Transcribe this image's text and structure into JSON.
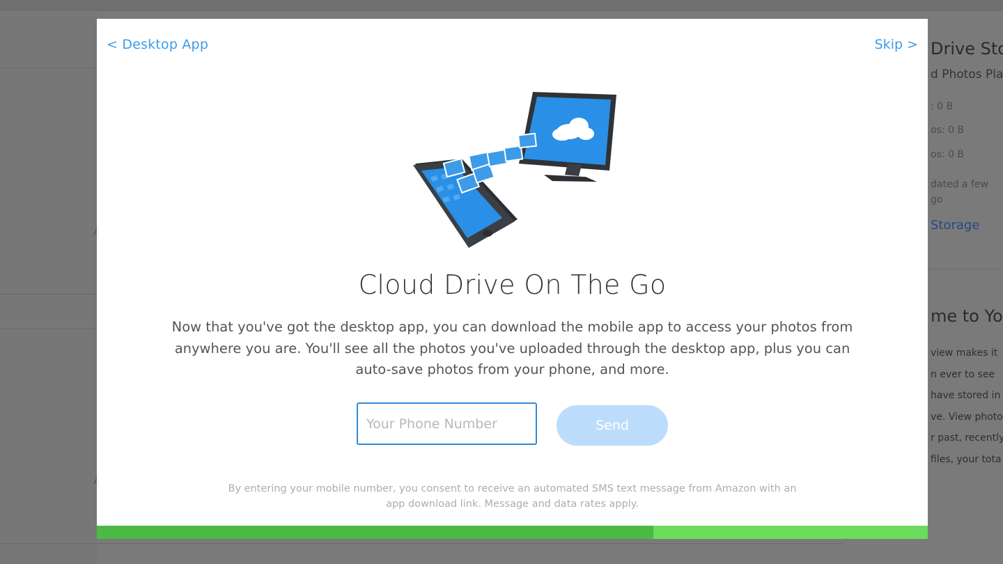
{
  "background": {
    "right_panel": {
      "title": "Drive Sto",
      "subtitle": "d Photos Pla",
      "stat_1": ": 0 B",
      "stat_2": "os: 0 B",
      "stat_3": "os: 0 B",
      "updated_line_1": "dated a few",
      "updated_line_2": "go",
      "storage_link": "Storage",
      "welcome_heading": "me to Yo",
      "body_lines": [
        "view makes it",
        "n ever to see",
        "have stored in",
        "ve. View photo",
        "r past, recently",
        "files, your tota"
      ]
    },
    "left_letters": [
      "A",
      "A"
    ]
  },
  "modal": {
    "back_label": "< Desktop App",
    "skip_label": "Skip >",
    "headline": "Cloud Drive On The Go",
    "description": "Now that you've got the desktop app, you can download the mobile app to access your photos from anywhere you are. You'll see all the photos you've uploaded through the desktop app, plus you can auto-save photos from your phone, and more.",
    "phone_input": {
      "placeholder": "Your Phone Number",
      "value": ""
    },
    "send_label": "Send",
    "disclaimer": "By entering your mobile number, you consent to receive an automated SMS text message from Amazon with an app download link. Message and data rates apply.",
    "progress_fraction": 0.67
  },
  "colors": {
    "link_blue": "#3d9be9",
    "input_border": "#2f8ad8",
    "send_button_disabled": "#bcdcfb",
    "progress_filled": "#4cb943",
    "progress_remaining": "#6bdc5c"
  }
}
